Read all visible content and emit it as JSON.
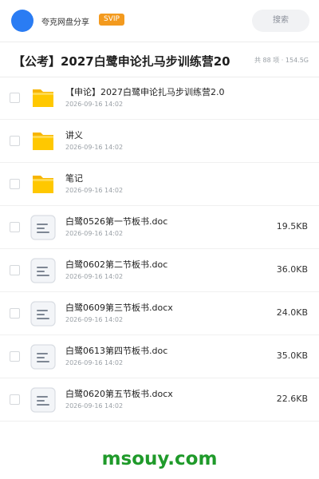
{
  "header": {
    "app_name": "夸克网盘分享",
    "badge": "SVIP",
    "search_label": "搜索",
    "accent_color": "#2a7cf3",
    "badge_color": "#f39a1e"
  },
  "share": {
    "title": "【公考】2027白鹭申论扎马步训练营20",
    "count_info": "共 88 项 · 154.5G"
  },
  "files": [
    {
      "type": "folder",
      "icon": "folder-icon",
      "name": "【申论】2027白鹭申论扎马步训练营2.0",
      "date": "2026-09-16 14:02",
      "size": ""
    },
    {
      "type": "folder",
      "icon": "folder-icon",
      "name": "讲义",
      "date": "2026-09-16 14:02",
      "size": ""
    },
    {
      "type": "folder",
      "icon": "folder-icon",
      "name": "笔记",
      "date": "2026-09-16 14:02",
      "size": ""
    },
    {
      "type": "doc",
      "icon": "document-icon",
      "name": "白鹭0526第一节板书.doc",
      "date": "2026-09-16 14:02",
      "size": "19.5KB"
    },
    {
      "type": "doc",
      "icon": "document-icon",
      "name": "白鹭0602第二节板书.doc",
      "date": "2026-09-16 14:02",
      "size": "36.0KB"
    },
    {
      "type": "doc",
      "icon": "document-icon",
      "name": "白鹭0609第三节板书.docx",
      "date": "2026-09-16 14:02",
      "size": "24.0KB"
    },
    {
      "type": "doc",
      "icon": "document-icon",
      "name": "白鹭0613第四节板书.doc",
      "date": "2026-09-16 14:02",
      "size": "35.0KB"
    },
    {
      "type": "doc",
      "icon": "document-icon",
      "name": "白鹭0620第五节板书.docx",
      "date": "2026-09-16 14:02",
      "size": "22.6KB"
    }
  ],
  "watermark": "msouy.com"
}
